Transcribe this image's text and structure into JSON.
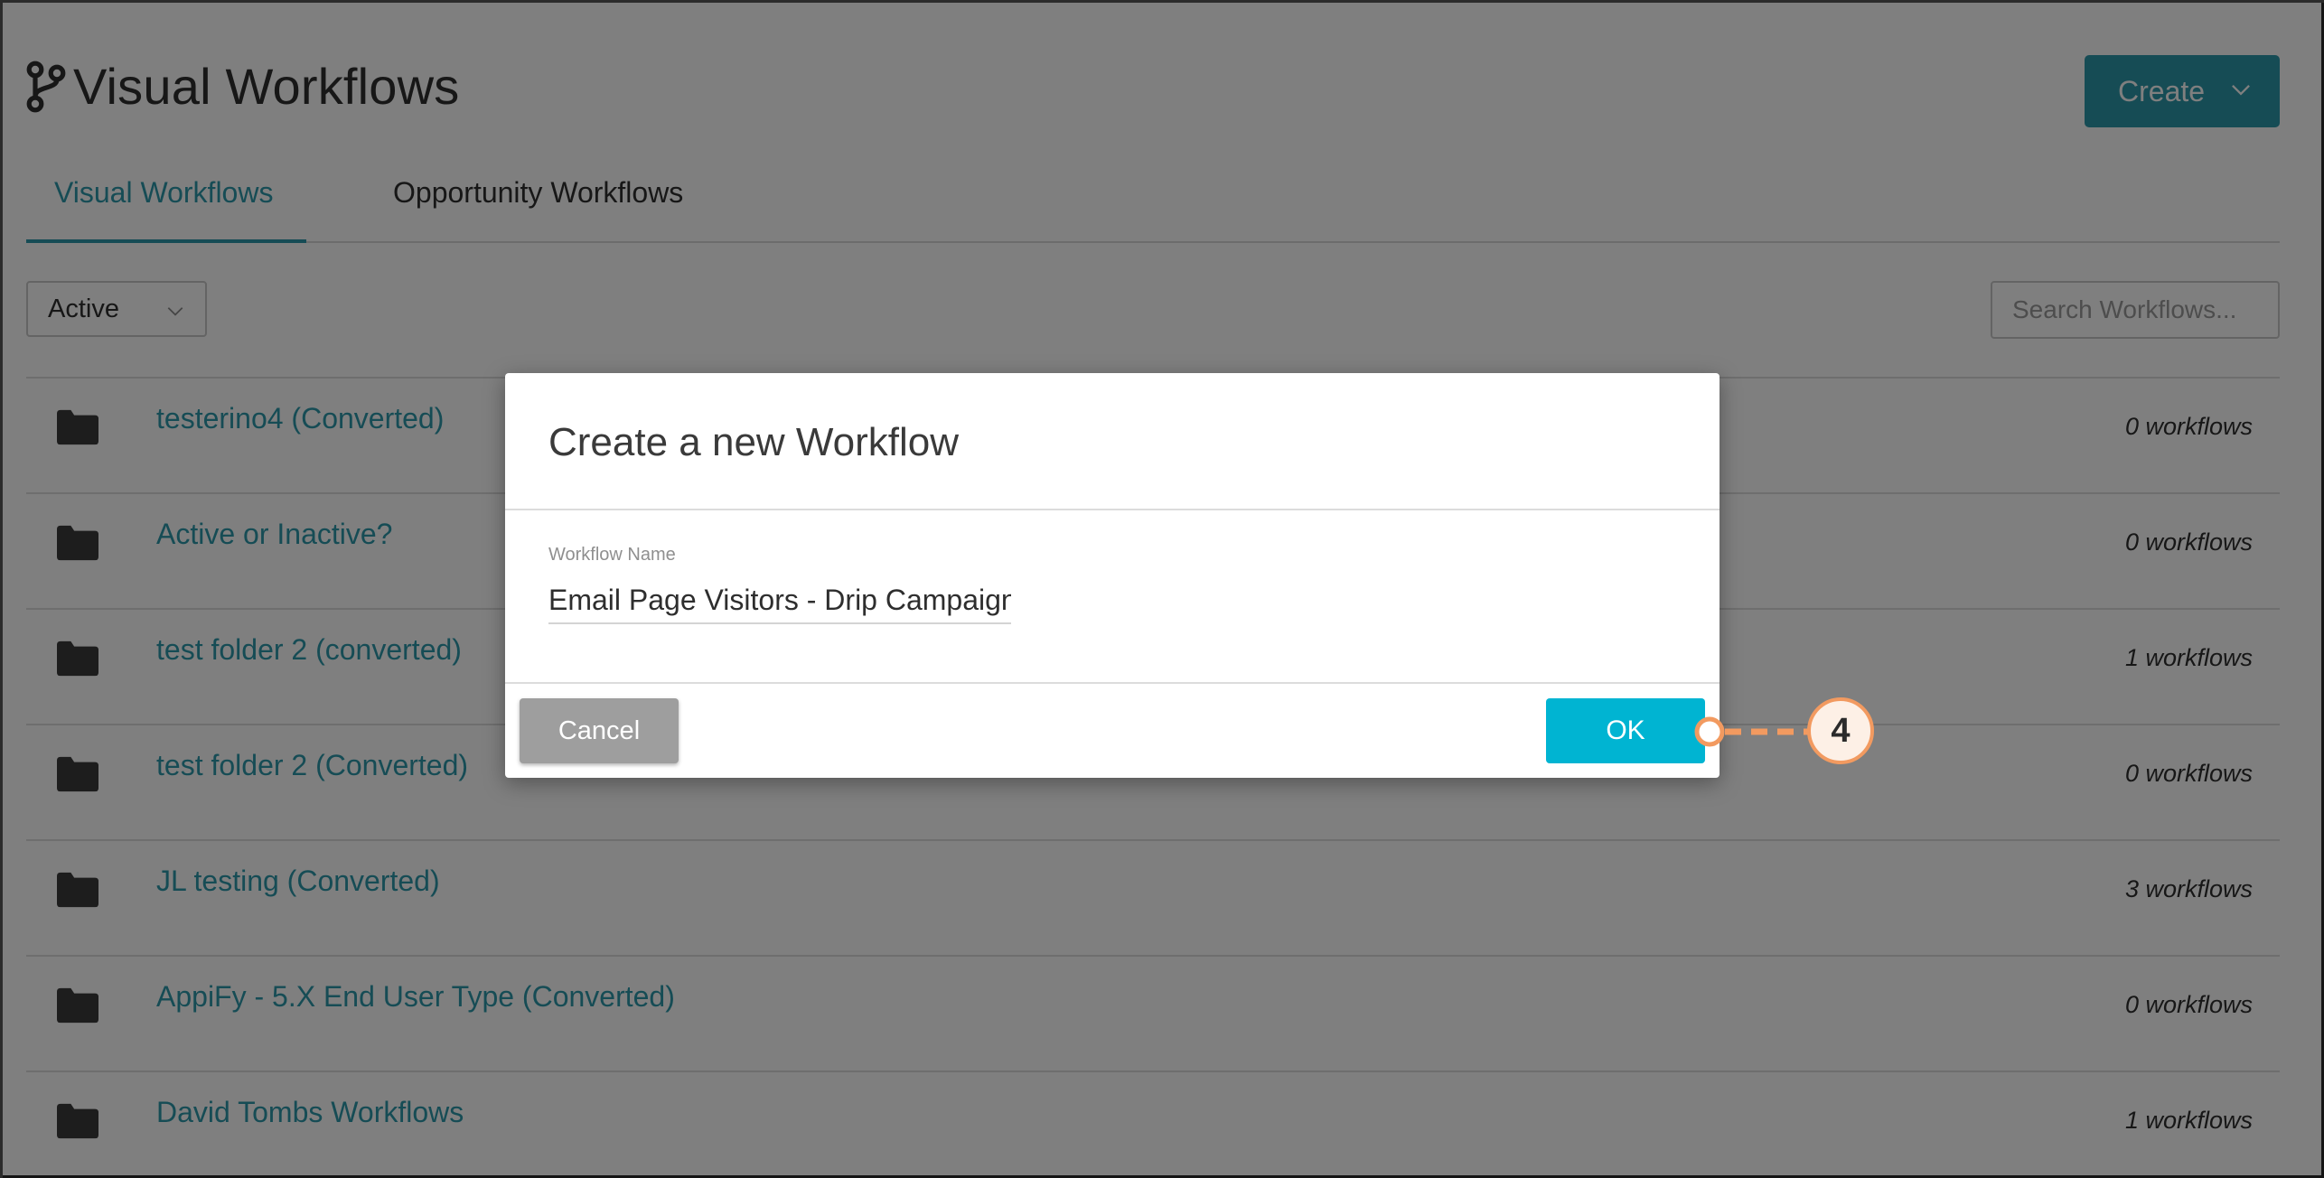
{
  "header": {
    "title": "Visual Workflows",
    "create_label": "Create"
  },
  "tabs": [
    {
      "label": "Visual Workflows",
      "active": true
    },
    {
      "label": "Opportunity Workflows",
      "active": false
    }
  ],
  "filter": {
    "selected": "Active"
  },
  "search": {
    "placeholder": "Search Workflows..."
  },
  "folders": [
    {
      "name": "testerino4 (Converted)",
      "count": "0 workflows"
    },
    {
      "name": "Active or Inactive?",
      "count": "0 workflows"
    },
    {
      "name": "test folder 2 (converted)",
      "count": "1 workflows"
    },
    {
      "name": "test folder 2 (Converted)",
      "count": "0 workflows"
    },
    {
      "name": "JL testing (Converted)",
      "count": "3 workflows"
    },
    {
      "name": "AppiFy - 5.X End User Type (Converted)",
      "count": "0 workflows"
    },
    {
      "name": "David Tombs Workflows",
      "count": "1 workflows"
    }
  ],
  "modal": {
    "title": "Create a new Workflow",
    "field_label": "Workflow Name",
    "field_value": "Email Page Visitors - Drip Campaign",
    "cancel_label": "Cancel",
    "ok_label": "OK"
  },
  "callout": {
    "number": "4"
  },
  "colors": {
    "accent": "#2c99aa",
    "ok": "#00b4d2",
    "callout": "#f29a60",
    "cancel": "#9e9e9e"
  },
  "icons": {
    "title": "branch-icon",
    "folder": "folder-icon",
    "caret": "chevron-down-icon"
  }
}
